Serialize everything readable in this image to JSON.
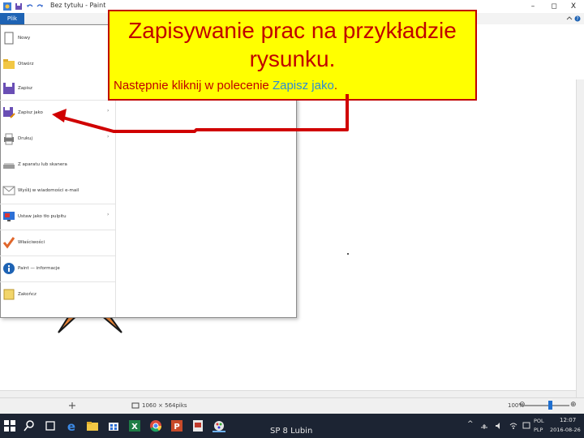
{
  "window": {
    "title": "Bez tytułu - Paint",
    "minimize_glyph": "–",
    "maximize_glyph": "◻",
    "close_glyph": "X"
  },
  "ribbon": {
    "file_tab_label": "Plik",
    "help_icon": "question-icon"
  },
  "file_menu": {
    "items": [
      {
        "label": "Nowy",
        "icon": "new-document-icon",
        "has_submenu": false
      },
      {
        "label": "Otwórz",
        "icon": "open-folder-icon",
        "has_submenu": false
      },
      {
        "label": "Zapisz",
        "icon": "save-disk-icon",
        "has_submenu": false
      },
      {
        "label": "Zapisz jako",
        "icon": "save-as-icon",
        "has_submenu": true
      },
      {
        "label": "Drukuj",
        "icon": "printer-icon",
        "has_submenu": true
      },
      {
        "label": "Z aparatu lub skanera",
        "icon": "scanner-icon",
        "has_submenu": false
      },
      {
        "label": "Wyślij w wiadomości e-mail",
        "icon": "email-icon",
        "has_submenu": false
      },
      {
        "label": "Ustaw jako tło pulpitu",
        "icon": "desktop-background-icon",
        "has_submenu": true
      },
      {
        "label": "Właściwości",
        "icon": "properties-check-icon",
        "has_submenu": false
      },
      {
        "label": "Paint — informacje",
        "icon": "info-icon",
        "has_submenu": false
      },
      {
        "label": "Zakończ",
        "icon": "exit-icon",
        "has_submenu": false
      }
    ],
    "submenu_arrow": "›"
  },
  "callout": {
    "title": "Zapisywanie prac na przykładzie rysunku.",
    "body_prefix": "Następnie kliknij w polecenie ",
    "body_highlight": "Zapisz jako",
    "body_suffix": ".",
    "border_color": "#c00000",
    "background_color": "#ffff00",
    "highlight_color": "#2e8bd6",
    "arrow_color": "#d00000"
  },
  "status_bar": {
    "canvas_size": "1060 × 564piks",
    "zoom_level": "100%",
    "zoom_out_glyph": "⊖",
    "zoom_in_glyph": "⊕"
  },
  "taskbar": {
    "center_text": "SP 8 Lubin",
    "language": "POL",
    "layout": "PLP",
    "time": "12:07",
    "date": "2016-08-26",
    "tray_up_glyph": "^"
  },
  "colors": {
    "accent_blue": "#1e63b4",
    "taskbar_bg": "#1c2433",
    "star_fill": "#f0883a"
  }
}
